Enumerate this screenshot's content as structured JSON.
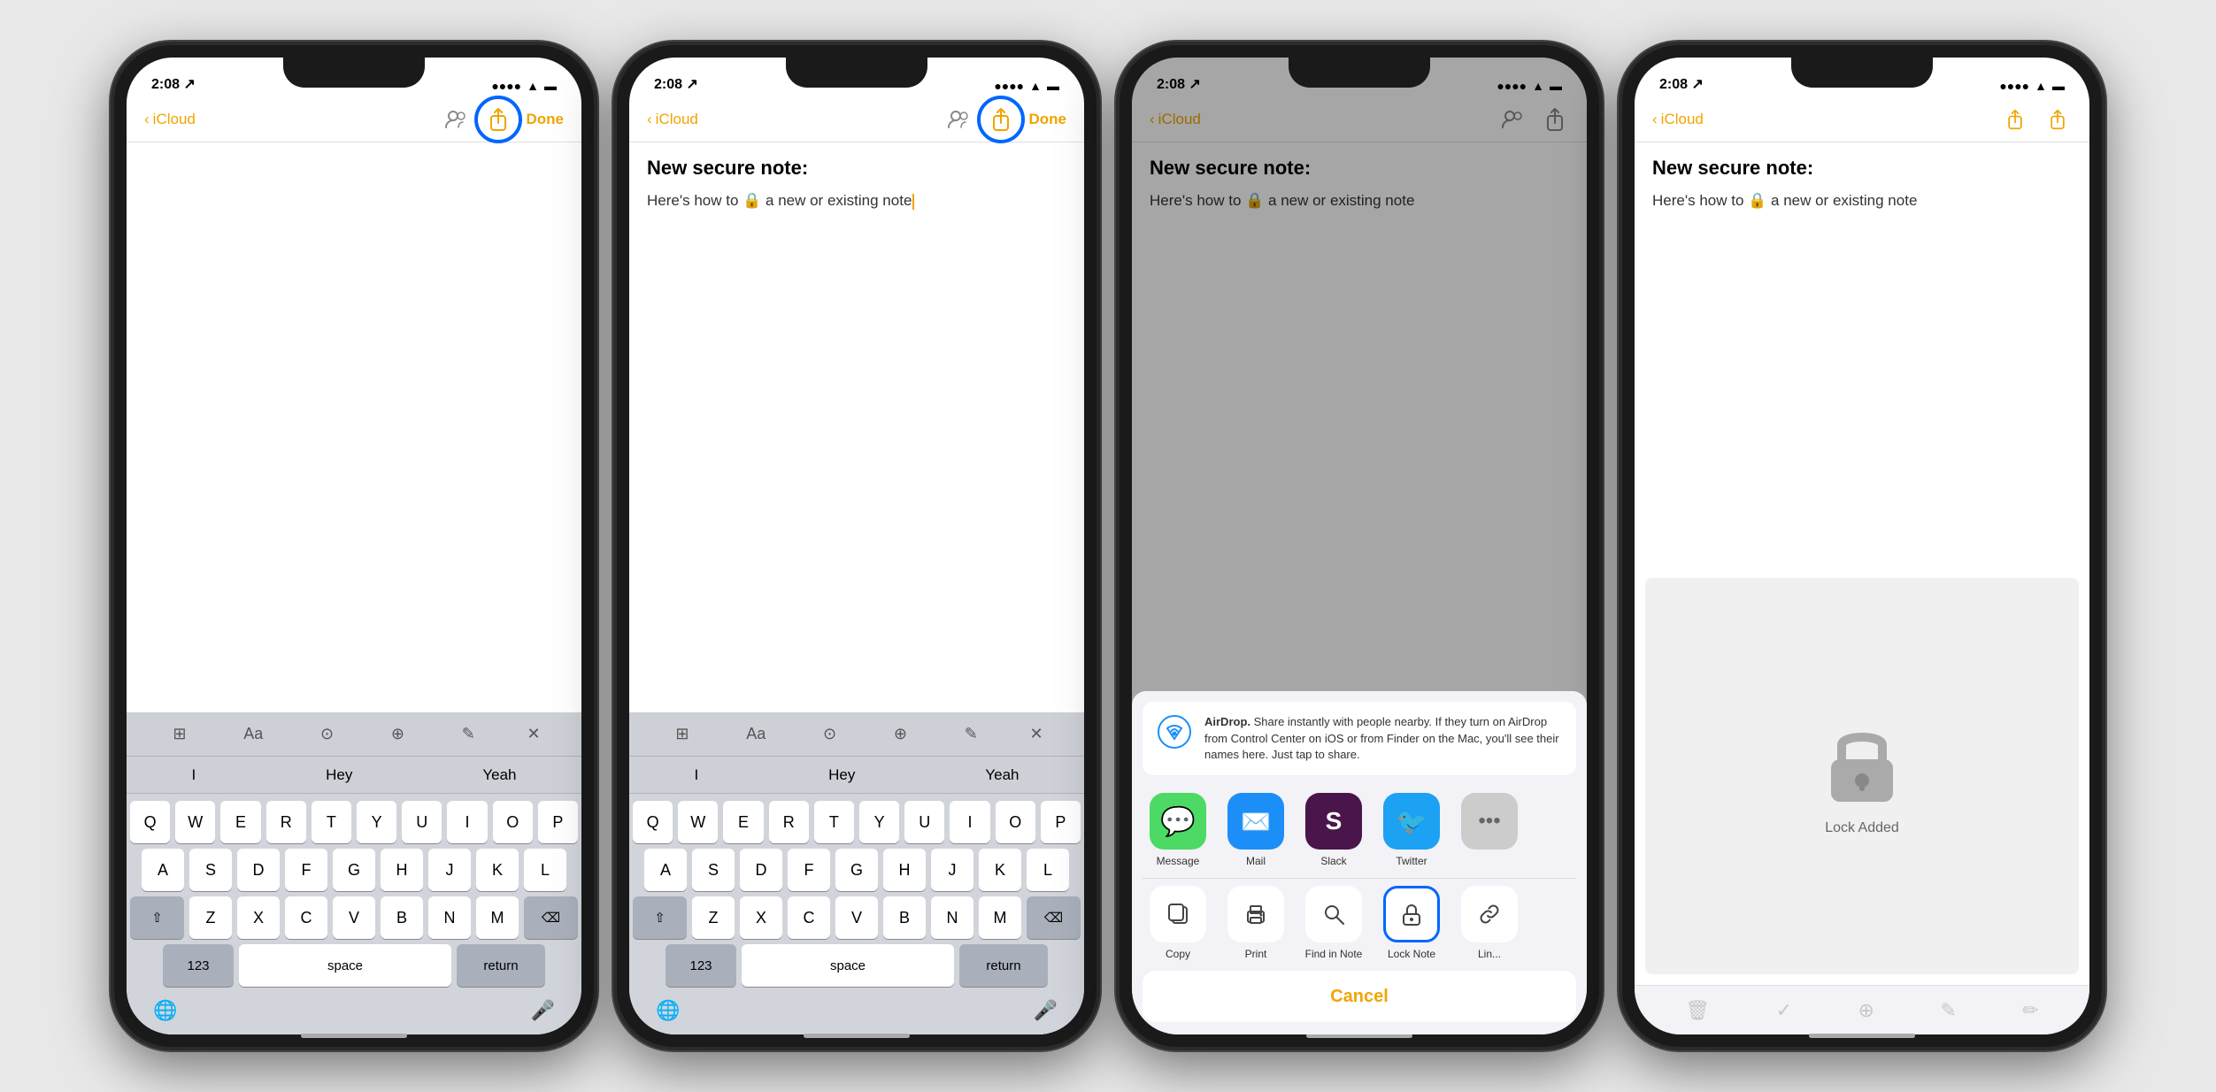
{
  "phones": [
    {
      "id": "phone1",
      "statusBar": {
        "time": "2:08",
        "signal": "●●●●",
        "wifi": "wifi",
        "battery": "battery"
      },
      "navBar": {
        "back": "iCloud",
        "done": "Done",
        "showShare": true,
        "shareHighlighted": true
      },
      "note": {
        "showTitle": false,
        "showBody": false,
        "showCursor": false
      },
      "showKeyboard": true,
      "suggestions": [
        "I",
        "Hey",
        "Yeah"
      ],
      "keys": [
        [
          "Q",
          "W",
          "E",
          "R",
          "T",
          "Y",
          "U",
          "I",
          "O",
          "P"
        ],
        [
          "A",
          "S",
          "D",
          "F",
          "G",
          "H",
          "J",
          "K",
          "L"
        ],
        [
          "⇧",
          "Z",
          "X",
          "C",
          "V",
          "B",
          "N",
          "M",
          "⌫"
        ],
        [
          "123",
          "space",
          "return"
        ]
      ]
    },
    {
      "id": "phone2",
      "statusBar": {
        "time": "2:08",
        "signal": "●●●●",
        "wifi": "wifi",
        "battery": "battery"
      },
      "navBar": {
        "back": "iCloud",
        "done": "Done",
        "showShare": true,
        "shareHighlighted": true
      },
      "note": {
        "showTitle": true,
        "title": "New secure note:",
        "showBody": true,
        "body": "Here's how to 🔒 a new or existing note",
        "showCursor": true
      },
      "showKeyboard": true,
      "suggestions": [
        "I",
        "Hey",
        "Yeah"
      ],
      "keys": [
        [
          "Q",
          "W",
          "E",
          "R",
          "T",
          "Y",
          "U",
          "I",
          "O",
          "P"
        ],
        [
          "A",
          "S",
          "D",
          "F",
          "G",
          "H",
          "J",
          "K",
          "L"
        ],
        [
          "⇧",
          "Z",
          "X",
          "C",
          "V",
          "B",
          "N",
          "M",
          "⌫"
        ],
        [
          "123",
          "space",
          "return"
        ]
      ]
    },
    {
      "id": "phone3",
      "statusBar": {
        "time": "2:08",
        "signal": "●●●●",
        "wifi": "wifi",
        "battery": "battery"
      },
      "navBar": {
        "back": "iCloud",
        "done": "",
        "showShare": true,
        "shareHighlighted": false
      },
      "note": {
        "showTitle": true,
        "title": "New secure note:",
        "showBody": true,
        "body": "Here's how to 🔒 a new or existing note",
        "showCursor": false
      },
      "showKeyboard": false,
      "showShareSheet": true,
      "shareSheet": {
        "airdropText": "AirDrop. Share instantly with people nearby. If they turn on AirDrop from Control Center on iOS or from Finder on the Mac, you'll see their names here. Just tap to share.",
        "apps": [
          {
            "label": "Message",
            "color": "#4cd964",
            "icon": "💬"
          },
          {
            "label": "Mail",
            "color": "#1c8ef7",
            "icon": "✉️"
          },
          {
            "label": "Slack",
            "color": "#4a154b",
            "icon": "S"
          },
          {
            "label": "Twitter",
            "color": "#1da1f2",
            "icon": "🐦"
          }
        ],
        "actions": [
          {
            "label": "Copy",
            "icon": "⧉",
            "highlighted": false
          },
          {
            "label": "Print",
            "icon": "🖨",
            "highlighted": false
          },
          {
            "label": "Find in Note",
            "icon": "🔍",
            "highlighted": false
          },
          {
            "label": "Lock Note",
            "icon": "🔒",
            "highlighted": true
          },
          {
            "label": "Lin...",
            "icon": "🔗",
            "highlighted": false
          }
        ],
        "cancelLabel": "Cancel"
      }
    },
    {
      "id": "phone4",
      "statusBar": {
        "time": "2:08",
        "signal": "●●●●",
        "wifi": "wifi",
        "battery": "battery"
      },
      "navBar": {
        "back": "iCloud",
        "done": "",
        "showShare": true,
        "shareHighlighted": false
      },
      "note": {
        "showTitle": true,
        "title": "New secure note:",
        "showBody": true,
        "body": "Here's how to 🔒 a new or existing note",
        "showCursor": false
      },
      "showKeyboard": false,
      "showLockAdded": true,
      "lockAdded": {
        "text": "Lock Added"
      }
    }
  ]
}
